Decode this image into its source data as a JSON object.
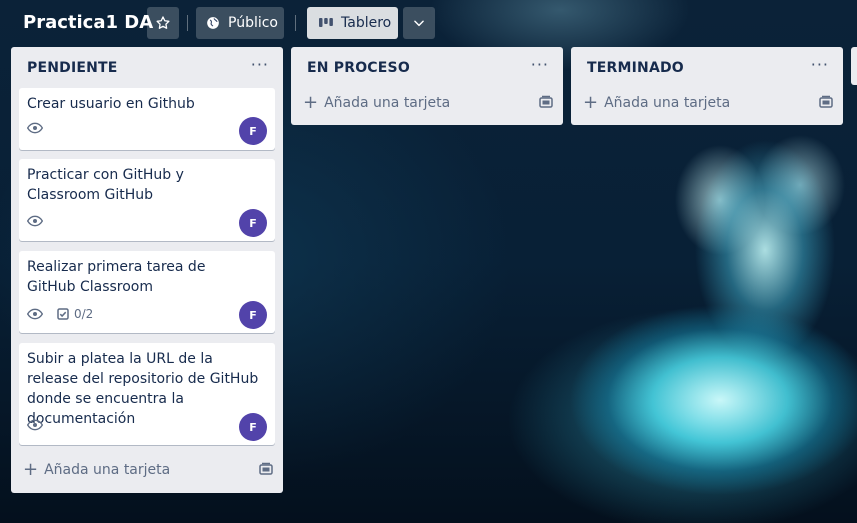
{
  "board": {
    "title": "Practica1 DA",
    "visibility_label": "Público",
    "view_label": "Tablero"
  },
  "icons": {
    "star": "star-icon",
    "visibility": "globe-icon",
    "view": "board-icon",
    "dropdown": "chevron-down-icon",
    "watch": "eye-icon",
    "checklist": "checklist-icon",
    "menu": "more-horizontal-icon",
    "add": "plus-icon",
    "template": "card-template-icon"
  },
  "colors": {
    "list_bg": "#ebecf0",
    "avatar": "#5243aa",
    "text": "#172b4d",
    "muted": "#5e6c84"
  },
  "lists": [
    {
      "title": "PENDIENTE",
      "menu_label": "···",
      "add_label": "Añada una tarjeta",
      "cards": [
        {
          "title": "Crear usuario en Github",
          "member": "F"
        },
        {
          "title": "Practicar con GitHub y Classroom GitHub",
          "member": "F"
        },
        {
          "title": "Realizar primera tarea de GitHub Classroom",
          "checklist": "0/2",
          "member": "F"
        },
        {
          "title": "Subir a platea la URL de la release del repositorio de GitHub donde se encuentra la documentación",
          "member": "F"
        }
      ]
    },
    {
      "title": "EN PROCESO",
      "menu_label": "···",
      "add_label": "Añada una tarjeta",
      "cards": []
    },
    {
      "title": "TERMINADO",
      "menu_label": "···",
      "add_label": "Añada una tarjeta",
      "cards": []
    }
  ]
}
